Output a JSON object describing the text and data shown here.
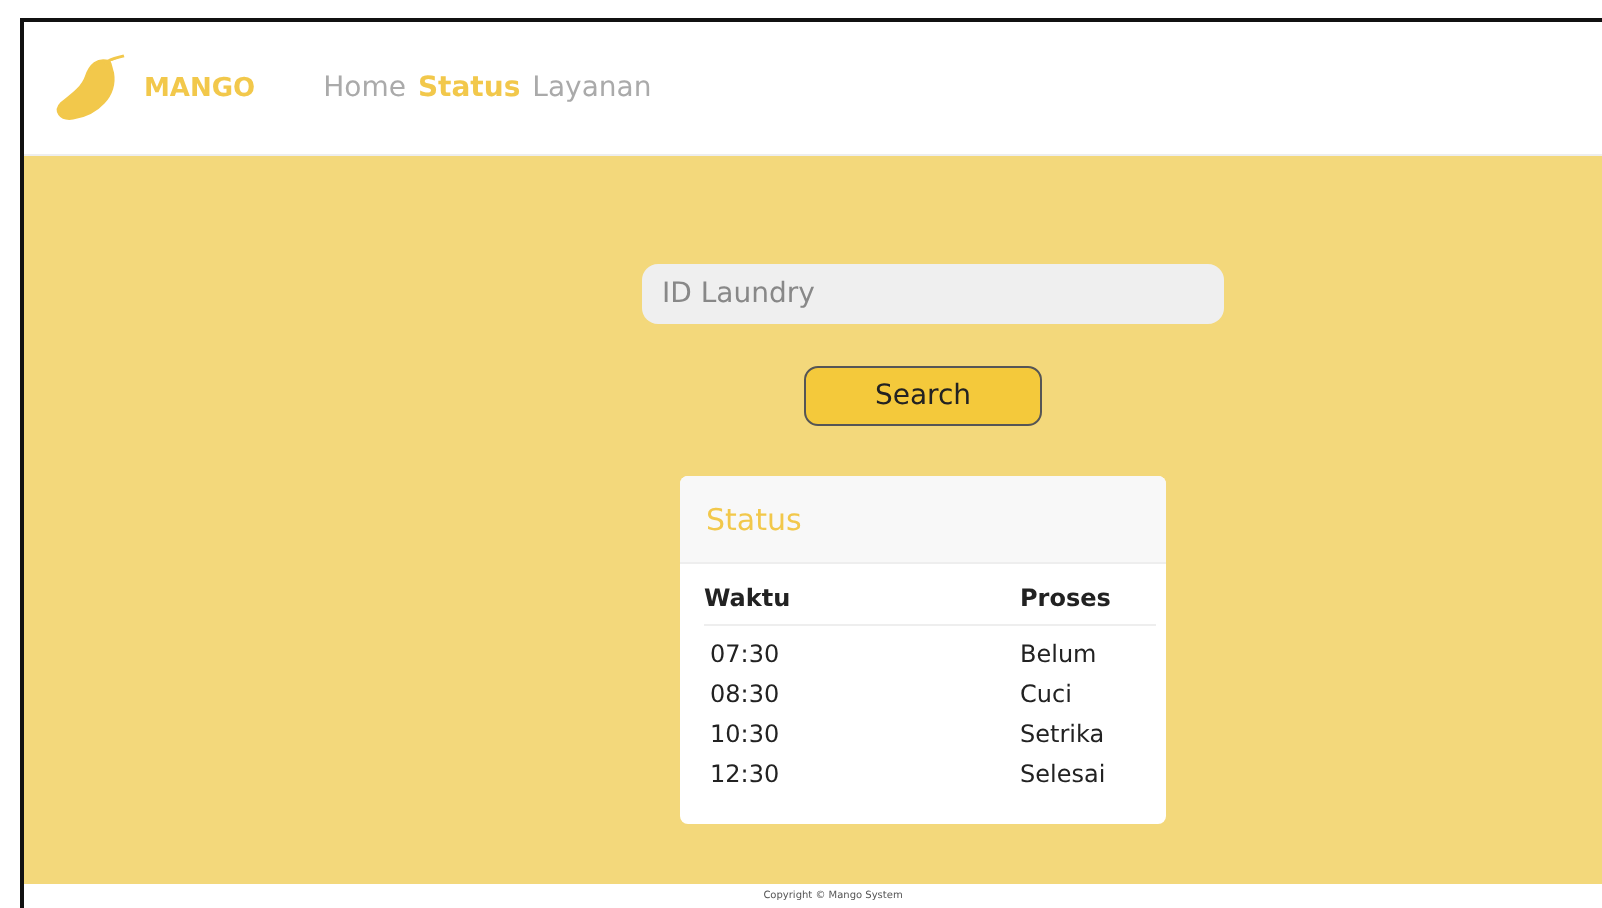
{
  "brand": "MANGO",
  "nav": [
    {
      "label": "Home",
      "selected": false
    },
    {
      "label": "Status",
      "selected": true
    },
    {
      "label": "Layanan",
      "selected": false
    }
  ],
  "search": {
    "placeholder": "ID Laundry",
    "button": "Search"
  },
  "status_card": {
    "title": "Status",
    "columns": [
      "Waktu",
      "Proses"
    ],
    "rows": [
      [
        "07:30",
        "Belum"
      ],
      [
        "08:30",
        "Cuci"
      ],
      [
        "10:30",
        "Setrika"
      ],
      [
        "12:30",
        "Selesai"
      ]
    ]
  },
  "footer": "Copyright © Mango System"
}
